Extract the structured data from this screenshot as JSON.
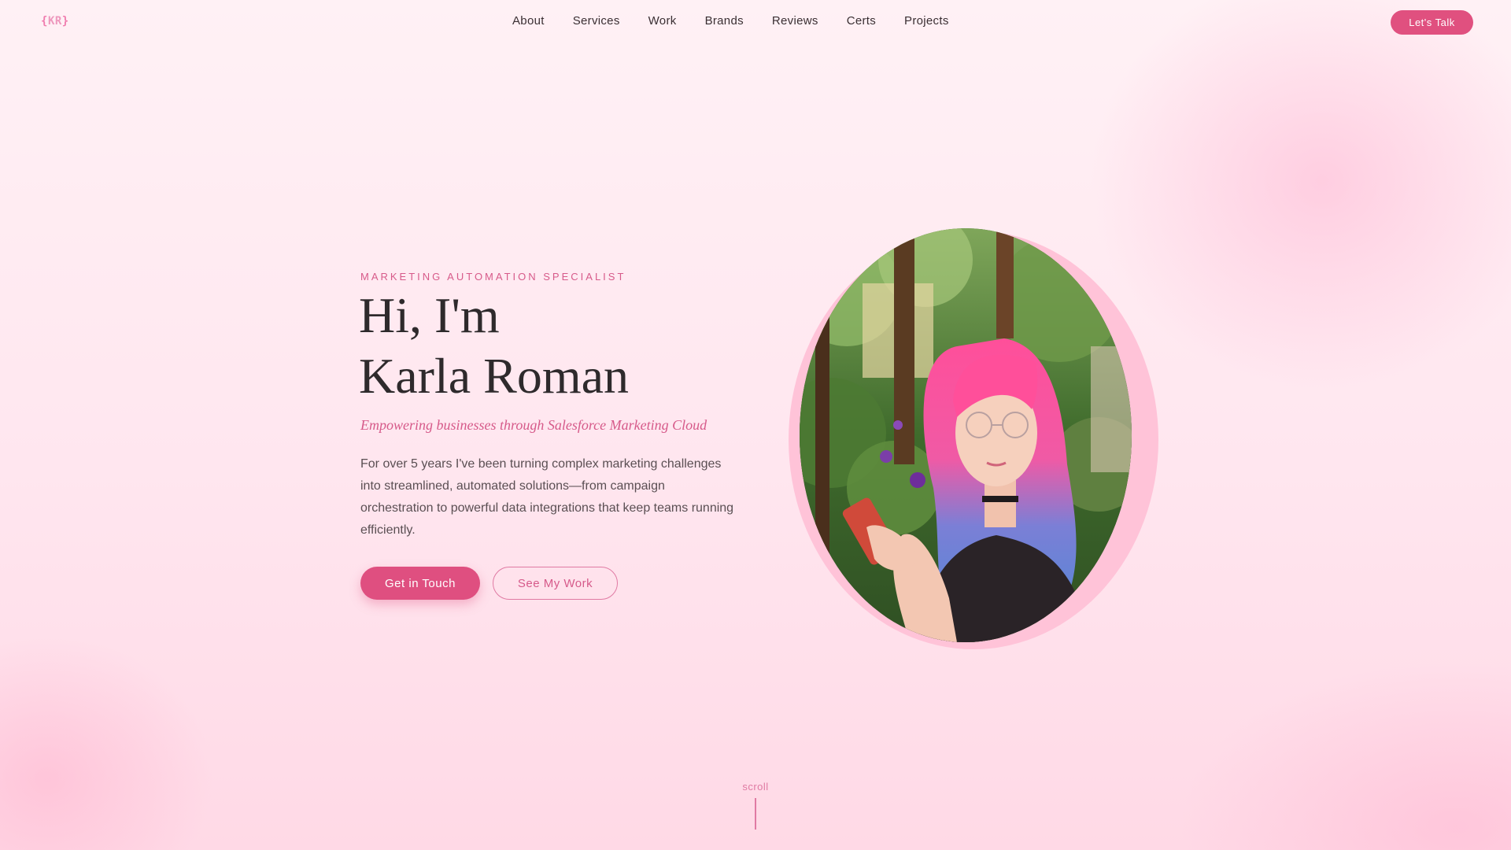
{
  "nav": {
    "logo": {
      "open": "{",
      "text": "KR",
      "close": "}"
    },
    "links": [
      "About",
      "Services",
      "Work",
      "Brands",
      "Reviews",
      "Certs",
      "Projects"
    ],
    "cta_label": "Let's Talk"
  },
  "hero": {
    "eyebrow": "MARKETING AUTOMATION SPECIALIST",
    "headline_line1": "Hi, I'm",
    "headline_line2": "Karla Roman",
    "tagline": "Empowering businesses through Salesforce Marketing Cloud",
    "intro": "For over 5 years I've been turning complex marketing challenges into streamlined, automated solutions—from campaign orchestration to powerful data integrations that keep teams running efficiently.",
    "primary_button": "Get in Touch",
    "secondary_button": "See My Work"
  },
  "scroll": {
    "label": "scroll"
  },
  "colors": {
    "accent": "#df4f80",
    "accent_light": "#e07aa3",
    "background": "#ffe6ef",
    "text_dark": "#2e2a2c"
  }
}
